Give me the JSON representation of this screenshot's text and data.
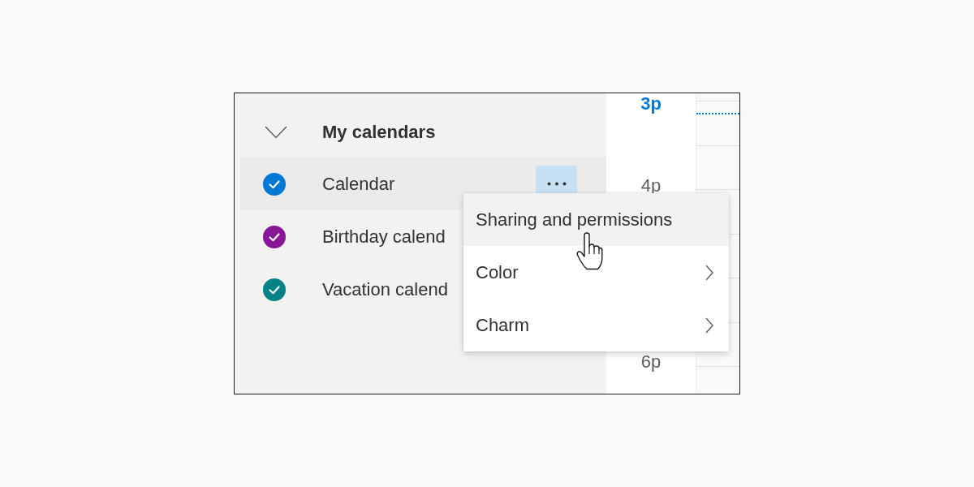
{
  "sidebar": {
    "section": {
      "title": "My calendars",
      "expanded": true
    },
    "calendars": [
      {
        "name": "Calendar",
        "checked": true,
        "color": "#0078d4",
        "selected": true
      },
      {
        "name": "Birthday calend",
        "checked": true,
        "color": "#881798",
        "selected": false
      },
      {
        "name": "Vacation calend",
        "checked": true,
        "color": "#038387",
        "selected": false
      }
    ]
  },
  "time_column": {
    "hours": [
      {
        "label": "3p",
        "current": true
      },
      {
        "label": "4p",
        "current": false
      },
      {
        "label": "6p",
        "current": false
      }
    ]
  },
  "context_menu": {
    "items": [
      {
        "label": "Sharing and permissions",
        "selected": true,
        "submenu": false
      },
      {
        "label": "Color",
        "selected": false,
        "submenu": true
      },
      {
        "label": "Charm",
        "selected": false,
        "submenu": true
      }
    ]
  }
}
